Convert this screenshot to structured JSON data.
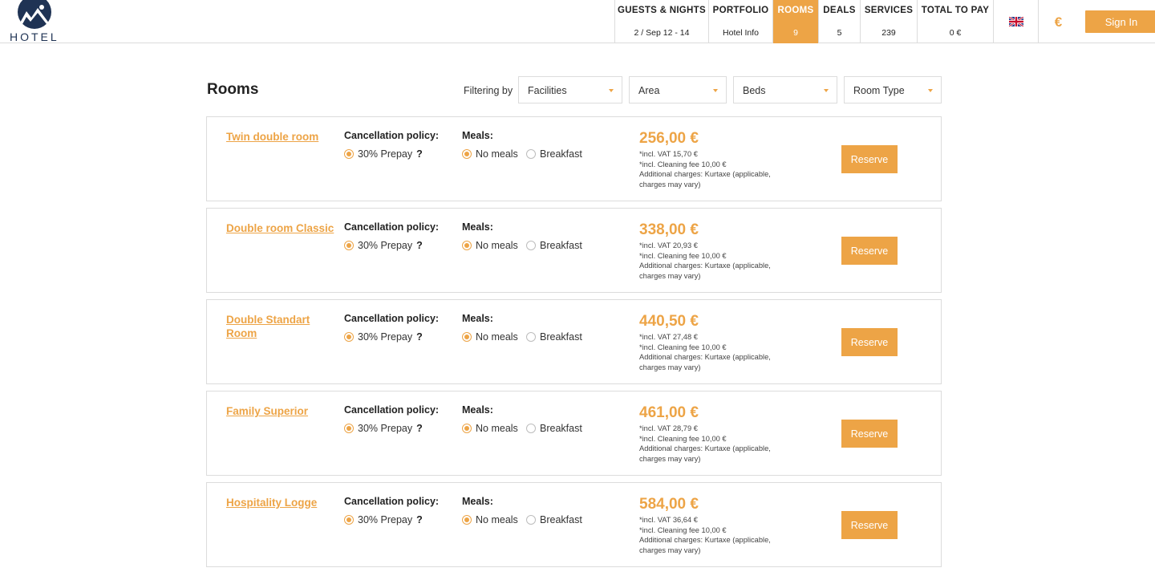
{
  "brand": {
    "logo_text": "HOTEL"
  },
  "nav": {
    "items": [
      {
        "label": "GUESTS & NIGHTS",
        "value": "2 / Sep 12 - 14"
      },
      {
        "label": "PORTFOLIO",
        "value": "Hotel Info"
      },
      {
        "label": "ROOMS",
        "value": "9"
      },
      {
        "label": "DEALS",
        "value": "5"
      },
      {
        "label": "SERVICES",
        "value": "239"
      },
      {
        "label": "TOTAL TO PAY",
        "value": "0 €"
      }
    ],
    "active_item": "ROOMS",
    "language_icon": "uk-flag-icon",
    "currency_symbol": "€",
    "signin_label": "Sign In"
  },
  "rooms_page": {
    "title": "Rooms",
    "filter_label": "Filtering by",
    "filters": [
      "Facilities",
      "Area",
      "Beds",
      "Room Type"
    ]
  },
  "labels": {
    "cancellation": "Cancellation policy:",
    "prepay": "30% Prepay",
    "help": "?",
    "meals": "Meals:",
    "no_meals": "No meals",
    "breakfast": "Breakfast",
    "reserve": "Reserve"
  },
  "rooms": [
    {
      "name": "Twin double room",
      "price": "256,00 €",
      "vat": "*incl. VAT 15,70 €",
      "cleaning": "*incl. Cleaning fee 10,00 €",
      "additional": "Additional charges: Kurtaxe (applicable, charges may vary)"
    },
    {
      "name": "Double room Classic",
      "price": "338,00 €",
      "vat": "*incl. VAT 20,93 €",
      "cleaning": "*incl. Cleaning fee 10,00 €",
      "additional": "Additional charges: Kurtaxe (applicable, charges may vary)"
    },
    {
      "name": "Double Standart Room",
      "price": "440,50 €",
      "vat": "*incl. VAT 27,48 €",
      "cleaning": "*incl. Cleaning fee 10,00 €",
      "additional": "Additional charges: Kurtaxe (applicable, charges may vary)"
    },
    {
      "name": "Family Superior",
      "price": "461,00 €",
      "vat": "*incl. VAT 28,79 €",
      "cleaning": "*incl. Cleaning fee 10,00 €",
      "additional": "Additional charges: Kurtaxe (applicable, charges may vary)"
    },
    {
      "name": "Hospitality Logge",
      "price": "584,00 €",
      "vat": "*incl. VAT 36,64 €",
      "cleaning": "*incl. Cleaning fee 10,00 €",
      "additional": "Additional charges: Kurtaxe (applicable, charges may vary)"
    }
  ],
  "colors": {
    "accent": "#eda446",
    "border": "#dcdcdc",
    "logo": "#1f3354"
  }
}
